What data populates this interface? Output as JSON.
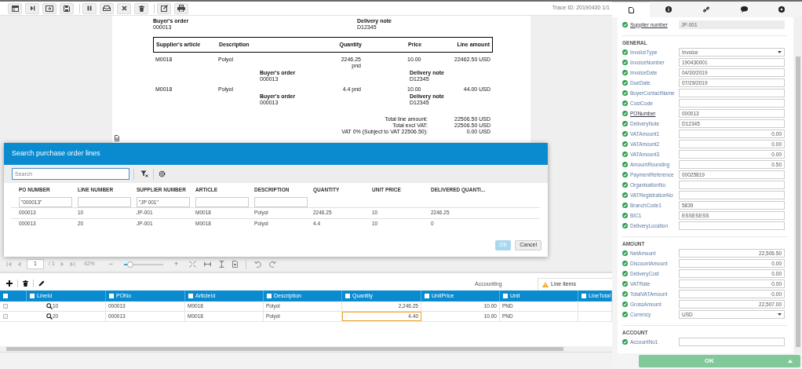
{
  "toolbar": {
    "trace": "Trace ID: 20190430 1/1"
  },
  "document": {
    "header": [
      {
        "label": "Buyer's order",
        "value": "000013"
      },
      {
        "label": "Delivery note",
        "value": "D12345"
      }
    ],
    "columns": [
      "Supplier's article",
      "Description",
      "Quantity",
      "Price",
      "Line amount"
    ],
    "lines": [
      {
        "article": "M0018",
        "description": "Polyol",
        "quantity": "2246.25 pnd",
        "price": "10.00",
        "amount": "22462.50 USD",
        "refs": [
          {
            "label": "Buyer's order",
            "value": "000013"
          },
          {
            "label": "Delivery note",
            "value": "D12345"
          }
        ]
      },
      {
        "article": "M0018",
        "description": "Polyol",
        "quantity": "4.4 pnd",
        "price": "10.00",
        "amount": "44.00 USD",
        "refs": [
          {
            "label": "Buyer's order",
            "value": "000013"
          },
          {
            "label": "Delivery note",
            "value": "D12345"
          }
        ]
      }
    ],
    "totals": [
      {
        "label": "Total line amount:",
        "value": "22506.50 USD"
      },
      {
        "label": "Total excl VAT:",
        "value": "22506.50 USD"
      },
      {
        "label": "VAT 0% (Subject to VAT 22506.50):",
        "value": "0.00 USD"
      }
    ]
  },
  "dialog": {
    "title": "Search purchase order lines",
    "search": {
      "placeholder": "Search"
    },
    "columns": [
      {
        "label": "PO NUMBER",
        "filter": true,
        "filter_value": "\"000013\""
      },
      {
        "label": "LINE NUMBER",
        "filter": true
      },
      {
        "label": "SUPPLIER NUMBER",
        "filter": true,
        "filter_value": "\"JP 001\""
      },
      {
        "label": "ARTICLE",
        "filter": true
      },
      {
        "label": "DESCRIPTION",
        "filter": true
      },
      {
        "label": "QUANTITY",
        "filter": false
      },
      {
        "label": "UNIT PRICE",
        "filter": false
      },
      {
        "label": "DELIVERED QUANTI...",
        "filter": false
      }
    ],
    "rows": [
      [
        "000013",
        "10",
        "JP-001",
        "M0018",
        "Polyol",
        "2246.25",
        "10",
        "2246.25"
      ],
      [
        "000013",
        "20",
        "JP-001",
        "M0018",
        "Polyol",
        "4.4",
        "10",
        "0"
      ]
    ],
    "buttons": [
      {
        "label": "OK",
        "disabled": true
      },
      {
        "label": "Cancel",
        "disabled": false
      }
    ]
  },
  "viewer": {
    "page": "1",
    "pages": "/ 1",
    "zoom": "42%",
    "minus": "−",
    "plus": "+",
    "zoom_slider": {
      "level": 0.16
    }
  },
  "lines_panel": {
    "tabs": [
      {
        "label": "Accounting",
        "selected": false,
        "warning": false
      },
      {
        "label": "Line items",
        "selected": true,
        "warning": true
      }
    ],
    "all_checked": false,
    "columns": [
      {
        "label": "LineId",
        "checked": false
      },
      {
        "label": "PONo",
        "checked": false
      },
      {
        "label": "ArticleId",
        "checked": false
      },
      {
        "label": "Description",
        "checked": false
      },
      {
        "label": "Quantity",
        "checked": false
      },
      {
        "label": "UnitPrice",
        "checked": false
      },
      {
        "label": "Unit",
        "checked": false
      },
      {
        "label": "LineTotal",
        "checked": false
      }
    ],
    "rows": [
      {
        "checked": false,
        "cells": [
          {
            "text": "10",
            "focused": false
          },
          {
            "text": "000013",
            "focused": false
          },
          {
            "text": "M0018",
            "focused": false
          },
          {
            "text": "Polyol",
            "focused": false
          },
          {
            "text": "2,246.25",
            "focused": false
          },
          {
            "text": "10.00",
            "focused": false
          },
          {
            "text": "PND",
            "focused": false
          }
        ]
      },
      {
        "checked": false,
        "cells": [
          {
            "text": "20",
            "focused": false
          },
          {
            "text": "000013",
            "focused": false
          },
          {
            "text": "M0018",
            "focused": false
          },
          {
            "text": "Polyol",
            "focused": false
          },
          {
            "text": "4.40",
            "focused": true
          },
          {
            "text": "10.00",
            "focused": false
          },
          {
            "text": "PND",
            "focused": false
          }
        ]
      }
    ]
  },
  "fields_panel": {
    "tabs": [
      {
        "selected": true
      },
      {
        "selected": false
      },
      {
        "selected": false
      },
      {
        "selected": false
      },
      {
        "selected": false
      }
    ],
    "sections": [
      {
        "fields": [
          {
            "label": "Supplier number",
            "value": "JP-001",
            "kind": "readonly",
            "linked": true
          }
        ]
      },
      {
        "title": "GENERAL",
        "fields": [
          {
            "label": "InvoiceType",
            "value": "Invoice",
            "kind": "select",
            "linked": false
          },
          {
            "label": "InvoiceNumber",
            "value": "190430001",
            "kind": "text",
            "linked": false
          },
          {
            "label": "InvoiceDate",
            "value": "04/30/2019",
            "kind": "text",
            "linked": false
          },
          {
            "label": "DueDate",
            "value": "07/29/2019",
            "kind": "text",
            "linked": false
          },
          {
            "label": "BuyerContactName",
            "kind": "text",
            "linked": false
          },
          {
            "label": "CostCode",
            "kind": "text",
            "linked": false
          },
          {
            "label": "PONumber",
            "value": "000013",
            "kind": "text",
            "linked": true
          },
          {
            "label": "DeliveryNote",
            "value": "D12345",
            "kind": "text",
            "linked": false
          },
          {
            "label": "VATAmount1",
            "value": "0.00",
            "kind": "number",
            "linked": false
          },
          {
            "label": "VATAmount2",
            "value": "0.00",
            "kind": "number",
            "linked": false
          },
          {
            "label": "VATAmount3",
            "value": "0.00",
            "kind": "number",
            "linked": false
          },
          {
            "label": "AmountRounding",
            "value": "0.50",
            "kind": "number",
            "linked": false
          },
          {
            "label": "PaymentReference",
            "value": "00025819",
            "kind": "text",
            "linked": false
          },
          {
            "label": "OrganisationNo",
            "kind": "text",
            "linked": false
          },
          {
            "label": "VATRegistrationNo",
            "kind": "text",
            "linked": false
          },
          {
            "label": "BranchCode1",
            "value": "5839",
            "kind": "text",
            "linked": false
          },
          {
            "label": "BIC1",
            "value": "ESSESESS",
            "kind": "text",
            "linked": false
          },
          {
            "label": "DeliveryLocation",
            "kind": "text",
            "linked": false
          }
        ]
      },
      {
        "title": "AMOUNT",
        "fields": [
          {
            "label": "NetAmount",
            "value": "22,506.50",
            "kind": "number",
            "linked": false
          },
          {
            "label": "DiscountAmount",
            "value": "0.00",
            "kind": "number",
            "linked": false
          },
          {
            "label": "DeliveryCost",
            "value": "0.00",
            "kind": "number",
            "linked": false
          },
          {
            "label": "VATRate",
            "value": "0.00",
            "kind": "number",
            "linked": false
          },
          {
            "label": "TotalVATAmount",
            "value": "0.00",
            "kind": "number",
            "linked": false
          },
          {
            "label": "GrossAmount",
            "value": "22,507.00",
            "kind": "number",
            "linked": false
          },
          {
            "label": "Currency",
            "value": "USD",
            "kind": "select",
            "linked": false
          }
        ]
      },
      {
        "title": "ACCOUNT",
        "fields": [
          {
            "label": "AccountNo1",
            "kind": "text",
            "linked": false
          }
        ]
      }
    ]
  },
  "ok_button": {
    "label": "OK"
  }
}
